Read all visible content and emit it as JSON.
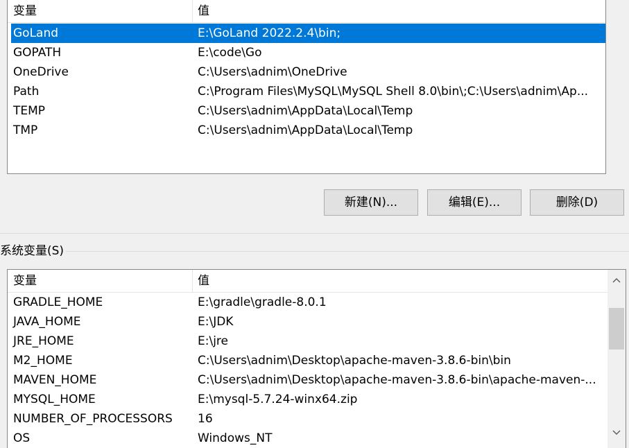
{
  "user_vars": {
    "header": {
      "name": "变量",
      "value": "值"
    },
    "rows": [
      {
        "name": "GoLand",
        "value": "E:\\GoLand 2022.2.4\\bin;"
      },
      {
        "name": "GOPATH",
        "value": "E:\\code\\Go"
      },
      {
        "name": "OneDrive",
        "value": "C:\\Users\\adnim\\OneDrive"
      },
      {
        "name": "Path",
        "value": "C:\\Program Files\\MySQL\\MySQL Shell 8.0\\bin\\;C:\\Users\\adnim\\Ap..."
      },
      {
        "name": "TEMP",
        "value": "C:\\Users\\adnim\\AppData\\Local\\Temp"
      },
      {
        "name": "TMP",
        "value": "C:\\Users\\adnim\\AppData\\Local\\Temp"
      }
    ],
    "selected_index": 0
  },
  "buttons": {
    "new_label": "新建(N)...",
    "edit_label": "编辑(E)...",
    "delete_label": "删除(D)"
  },
  "system_section_label": "系统变量(S)",
  "sys_vars": {
    "header": {
      "name": "变量",
      "value": "值"
    },
    "rows": [
      {
        "name": "GRADLE_HOME",
        "value": "E:\\gradle\\gradle-8.0.1"
      },
      {
        "name": "JAVA_HOME",
        "value": "E:\\JDK"
      },
      {
        "name": "JRE_HOME",
        "value": "E:\\jre"
      },
      {
        "name": "M2_HOME",
        "value": "C:\\Users\\adnim\\Desktop\\apache-maven-3.8.6-bin\\bin"
      },
      {
        "name": "MAVEN_HOME",
        "value": "C:\\Users\\adnim\\Desktop\\apache-maven-3.8.6-bin\\apache-maven-..."
      },
      {
        "name": "MYSQL_HOME",
        "value": "E:\\mysql-5.7.24-winx64.zip"
      },
      {
        "name": "NUMBER_OF_PROCESSORS",
        "value": "16"
      },
      {
        "name": "OS",
        "value": "Windows_NT"
      }
    ]
  },
  "icons": {
    "scroll_up": "chevron-up-icon",
    "scroll_down": "chevron-down-icon"
  },
  "colors": {
    "selection": "#0078d7",
    "button_bg": "#e1e1e1",
    "window_bg": "#f0f0f0"
  }
}
